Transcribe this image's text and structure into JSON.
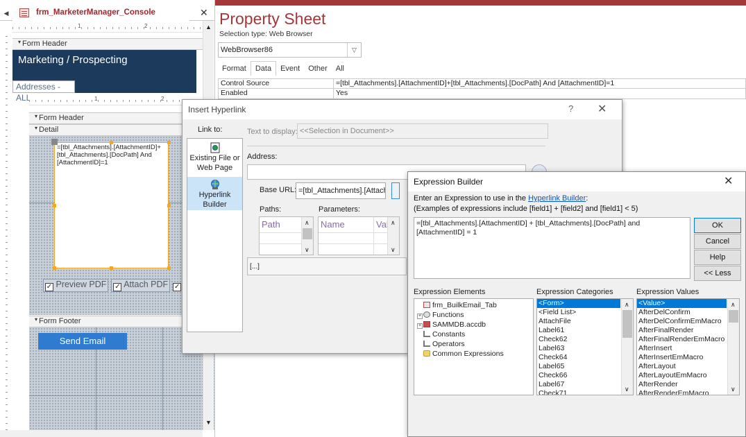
{
  "design": {
    "form_tab_title": "frm_MarketerManager_Console",
    "ruler_top": [
      "1",
      "2"
    ],
    "ruler_sub": [
      "1",
      "2"
    ],
    "form_header_label": "Form Header",
    "header_title": "Marketing  / Prospecting",
    "header_sub": "Addresses - ALL",
    "sub_form_header_label": "Form Header",
    "detail_label": "Detail",
    "browser_control_text": "=[tbl_Attachments].[AttachmentID]+[tbl_Attachments].[DocPath] And [AttachmentID]=1",
    "checkbox_preview": "Preview PDF",
    "checkbox_attach": "Attach PDF",
    "form_footer_label": "Form Footer",
    "send_email_label": "Send Email"
  },
  "property_sheet": {
    "title": "Property Sheet",
    "selection_type": "Selection type: Web Browser",
    "selected_control": "WebBrowser86",
    "tabs": [
      "Format",
      "Data",
      "Event",
      "Other",
      "All"
    ],
    "active_tab": "Data",
    "rows": [
      {
        "name": "Control Source",
        "value": "=[tbl_Attachments].[AttachmentID]+[tbl_Attachments].[DocPath] And [AttachmentID]=1"
      },
      {
        "name": "Enabled",
        "value": "Yes"
      }
    ]
  },
  "insert_hyperlink": {
    "title": "Insert Hyperlink",
    "help": "?",
    "link_to_label": "Link to:",
    "link_to_items": [
      {
        "label": "Existing File or Web Page"
      },
      {
        "label": "Hyperlink Builder"
      }
    ],
    "text_to_display_label": "Text to display:",
    "text_to_display_value": "<<Selection in Document>>",
    "address_label": "Address:",
    "base_url_label": "Base URL:",
    "base_url_value": "=[tbl_Attachments].[AttachmentID]",
    "paths_label": "Paths:",
    "parameters_label": "Parameters:",
    "paths_header": "Path",
    "params_header_name": "Name",
    "params_header_val": "Val",
    "preview_text": "[...]"
  },
  "expression_builder": {
    "title": "Expression Builder",
    "instruction_prefix": "Enter an Expression to use in the ",
    "instruction_link": "Hyperlink Builder",
    "instruction_suffix": ":",
    "examples": "(Examples of expressions include [field1] + [field2] and [field1] < 5)",
    "expression": "=[tbl_Attachments].[AttachmentID] + [tbl_Attachments].[DocPath] and [AttachmentID] = 1",
    "buttons": {
      "ok": "OK",
      "cancel": "Cancel",
      "help": "Help",
      "less": "<< Less"
    },
    "elements_header": "Expression Elements",
    "categories_header": "Expression Categories",
    "values_header": "Expression Values",
    "elements": [
      {
        "label": "frm_BuilkEmail_Tab",
        "expander": "",
        "icon": "form-icon"
      },
      {
        "label": "Functions",
        "expander": "+",
        "icon": "functions-icon"
      },
      {
        "label": "SAMMDB.accdb",
        "expander": "+",
        "icon": "database-icon"
      },
      {
        "label": "Constants",
        "expander": "",
        "icon": "constants-icon"
      },
      {
        "label": "Operators",
        "expander": "",
        "icon": "operators-icon"
      },
      {
        "label": "Common Expressions",
        "expander": "",
        "icon": "common-expressions-icon"
      }
    ],
    "categories": [
      "<Form>",
      "<Field List>",
      "AttachFile",
      "Label61",
      "Check62",
      "Label63",
      "Check64",
      "Label65",
      "Check66",
      "Label67",
      "Check71"
    ],
    "selected_category": "<Form>",
    "values": [
      "<Value>",
      "AfterDelConfirm",
      "AfterDelConfirmEmMacro",
      "AfterFinalRender",
      "AfterFinalRenderEmMacro",
      "AfterInsert",
      "AfterInsertEmMacro",
      "AfterLayout",
      "AfterLayoutEmMacro",
      "AfterRender",
      "AfterRenderEmMacro"
    ],
    "selected_value": "<Value>"
  }
}
